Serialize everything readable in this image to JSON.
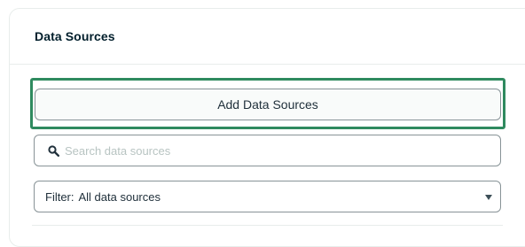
{
  "panel": {
    "title": "Data Sources"
  },
  "add_button": {
    "label": "Add Data Sources"
  },
  "search": {
    "placeholder": "Search data sources",
    "value": "",
    "icon": "search-icon"
  },
  "filter": {
    "label": "Filter:",
    "selected": "All data sources",
    "icon": "caret-down-icon"
  },
  "colors": {
    "focus_ring": "#2f8a5f",
    "title": "#001e2b",
    "border": "#889397"
  }
}
